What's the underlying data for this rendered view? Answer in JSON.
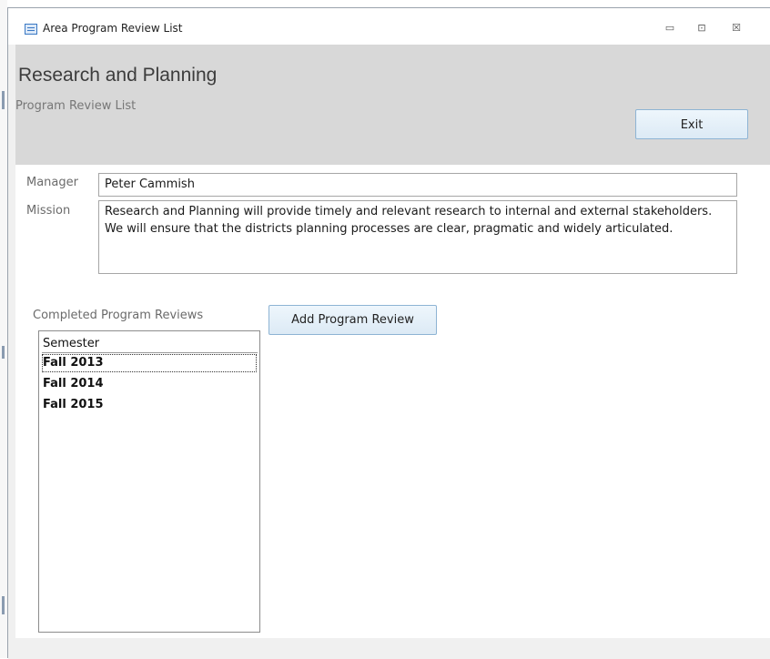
{
  "window": {
    "title": "Area Program Review List",
    "minimize_glyph": "▭",
    "maximize_glyph": "⊡",
    "close_glyph": "☒"
  },
  "header": {
    "title": "Research and Planning",
    "subtitle": "Program Review List",
    "exit_label": "Exit"
  },
  "form": {
    "manager_label": "Manager",
    "manager_value": "Peter Cammish",
    "mission_label": "Mission",
    "mission_value": "Research and Planning will provide timely and relevant research to internal and external stakeholders. We will ensure that the districts planning processes are clear, pragmatic and widely articulated."
  },
  "reviews": {
    "label": "Completed Program Reviews",
    "add_label": "Add Program Review",
    "column_header": "Semester",
    "items": [
      "Fall 2013",
      "Fall 2014",
      "Fall 2015"
    ]
  },
  "colors": {
    "header_bg": "#d8d8d8",
    "button_border": "#8eb4d4",
    "window_bg": "#f0f0f0"
  }
}
